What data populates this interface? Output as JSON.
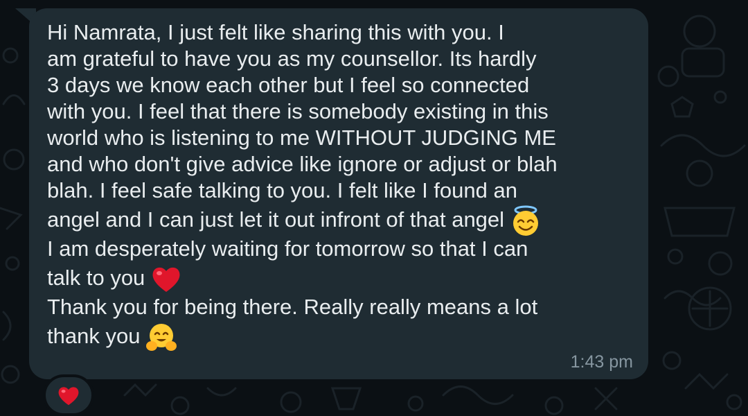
{
  "message": {
    "lines": [
      "Hi Namrata, I just felt like sharing this with you. I",
      "am grateful to have you as my counsellor. Its hardly",
      "3 days we know each other but I feel so connected",
      "with you. I feel that there is somebody existing in this",
      "world who is listening to me WITHOUT JUDGING ME",
      "and who don't give advice like ignore or adjust or blah",
      "blah. I feel safe talking to you. I felt like I found an",
      "angel and I can just let it out infront of that angel",
      "I am desperately waiting for tomorrow so that I can",
      "talk to you",
      "Thank you for being there. Really really means a lot",
      "thank you"
    ],
    "emojis": {
      "angel": "smiling-face-with-halo",
      "heart": "red-heart",
      "hug": "hugging-face"
    },
    "time": "1:43 pm"
  },
  "reaction": {
    "emoji": "red-heart"
  },
  "colors": {
    "background": "#0b1014",
    "bubble": "#1f2c33",
    "text": "#e9edef",
    "timestamp": "#8696a0",
    "heart": "#e0162b"
  }
}
